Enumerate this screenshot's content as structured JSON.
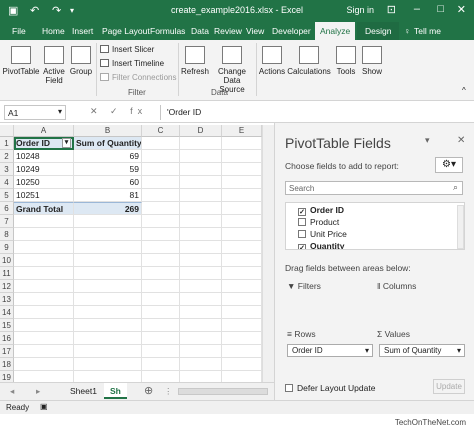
{
  "window": {
    "title": "create_example2016.xlsx - Excel",
    "sign_in": "Sign in",
    "minimize": "–",
    "maximize": "□",
    "close": "✕",
    "restore": "⊡"
  },
  "tabs": [
    "File",
    "Home",
    "Insert",
    "Page Layout",
    "Formulas",
    "Data",
    "Review",
    "View",
    "Developer",
    "Analyze",
    "Design"
  ],
  "tell_me": "Tell me",
  "ribbon": {
    "pivottable": "PivotTable",
    "active_field": [
      "Active",
      "Field"
    ],
    "group": "Group",
    "insert_slicer": "Insert Slicer",
    "insert_timeline": "Insert Timeline",
    "filter_connections": "Filter Connections",
    "filter_group": "Filter",
    "refresh": "Refresh",
    "change_source": [
      "Change Data",
      "Source"
    ],
    "data_group": "Data",
    "actions": "Actions",
    "calculations": "Calculations",
    "tools": "Tools",
    "show": "Show"
  },
  "formula_bar": {
    "name_box": "A1",
    "fx": "✕ ✓ fx",
    "value": "'Order ID"
  },
  "columns": [
    "A",
    "B",
    "C",
    "D",
    "E"
  ],
  "rows": [
    "1",
    "2",
    "3",
    "4",
    "5",
    "6",
    "7",
    "8",
    "9",
    "10",
    "11",
    "12",
    "13",
    "14",
    "15",
    "16",
    "17",
    "18",
    "19"
  ],
  "pivot": {
    "header": [
      "Order ID",
      "Sum of Quantity"
    ],
    "data": [
      [
        "10248",
        "69"
      ],
      [
        "10249",
        "59"
      ],
      [
        "10250",
        "60"
      ],
      [
        "10251",
        "81"
      ]
    ],
    "total": [
      "Grand Total",
      "269"
    ]
  },
  "sheets": [
    "Sheet1",
    "Sh"
  ],
  "status": "Ready",
  "pane": {
    "title": "PivotTable Fields",
    "subtitle": "Choose fields to add to report:",
    "search_placeholder": "Search",
    "fields": [
      {
        "name": "Order ID",
        "checked": true
      },
      {
        "name": "Product",
        "checked": false
      },
      {
        "name": "Unit Price",
        "checked": false
      },
      {
        "name": "Quantity",
        "checked": true
      }
    ],
    "drag_text": "Drag fields between areas below:",
    "filters": "Filters",
    "columns": "Columns",
    "rows_label": "Rows",
    "values_label": "Values",
    "rows_item": "Order ID",
    "values_item": "Sum of Quantity",
    "defer": "Defer Layout Update",
    "update": "Update",
    "close": "✕"
  },
  "credit": "TechOnTheNet.com",
  "colors": {
    "excel_green": "#217346",
    "pivot_header": "#dde8f3"
  }
}
